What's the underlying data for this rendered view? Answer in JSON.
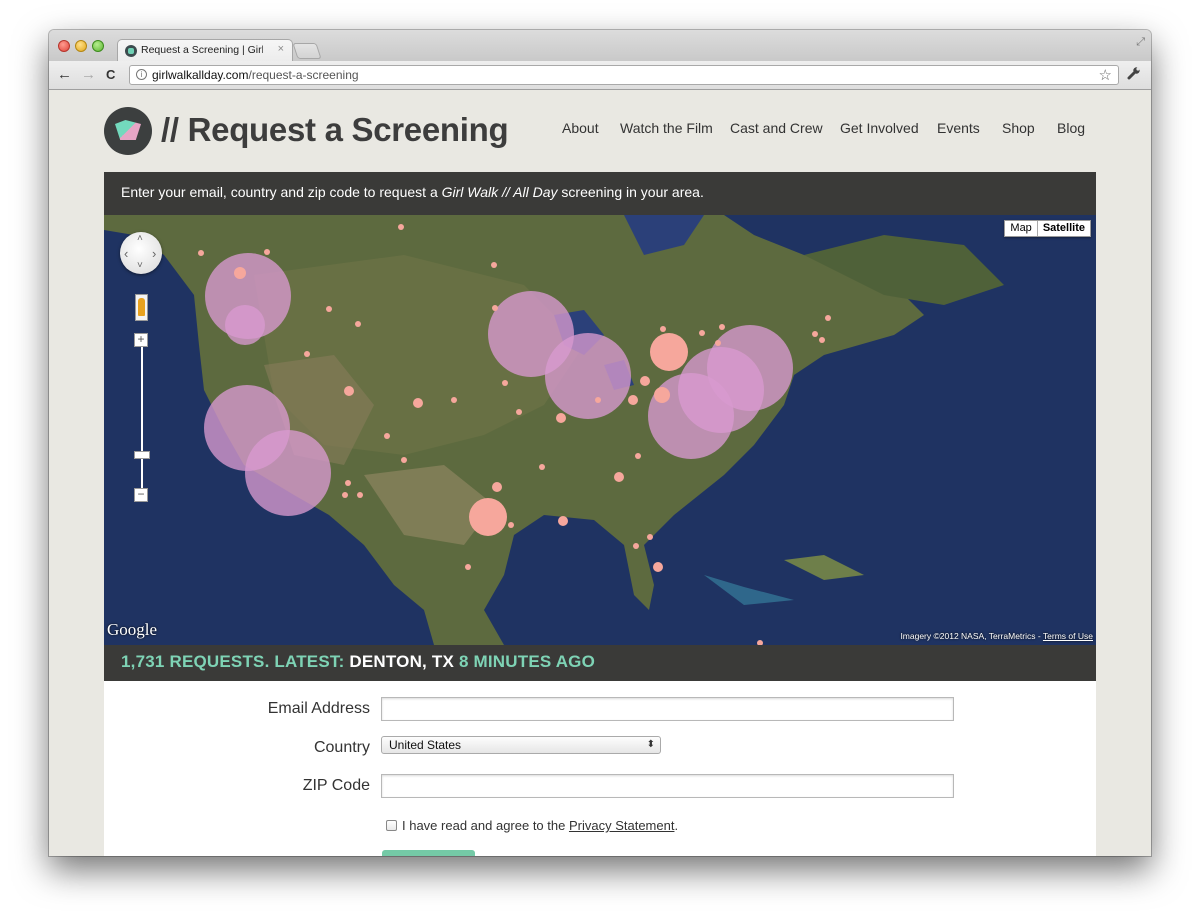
{
  "browser": {
    "tab_title": "Request a Screening | Girl Wa",
    "tab_close": "×",
    "url_host": "girlwalkallday.com",
    "url_path": "/request-a-screening",
    "back": "←",
    "forward": "→",
    "reload": "C",
    "star": "☆",
    "wrench": "🔧",
    "fullscreen": "⤢"
  },
  "site": {
    "title": "// Request a Screening",
    "nav": [
      "About",
      "Watch the Film",
      "Cast and Crew",
      "Get Involved",
      "Events",
      "Shop",
      "Blog"
    ]
  },
  "intro": {
    "before": "Enter your email, country and zip code to request a ",
    "film": "Girl Walk // All Day",
    "after": " screening in your area."
  },
  "map": {
    "type_map": "Map",
    "type_satellite": "Satellite",
    "google": "Google",
    "attribution": "Imagery ©2012 NASA, TerraMetrics - ",
    "terms": "Terms of Use",
    "zoom_in": "+",
    "zoom_out": "−",
    "pan_up": "˄",
    "pan_down": "˅",
    "pan_left": "‹",
    "pan_right": "›",
    "ocean_color": "#1f3362",
    "land_color": "#5d6a3f",
    "bubble_color": "#d99ad0",
    "dot_color": "#f6a79c"
  },
  "stats": {
    "count": "1,731 REQUESTS. LATEST: ",
    "city": "DENTON, TX",
    "ago": " 8 MINUTES AGO"
  },
  "form": {
    "email_label": "Email Address",
    "email_value": "",
    "country_label": "Country",
    "country_value": "United States",
    "zip_label": "ZIP Code",
    "zip_value": "",
    "agree_text": "I have read and agree to the ",
    "privacy_link": "Privacy Statement",
    "agree_end": "."
  }
}
